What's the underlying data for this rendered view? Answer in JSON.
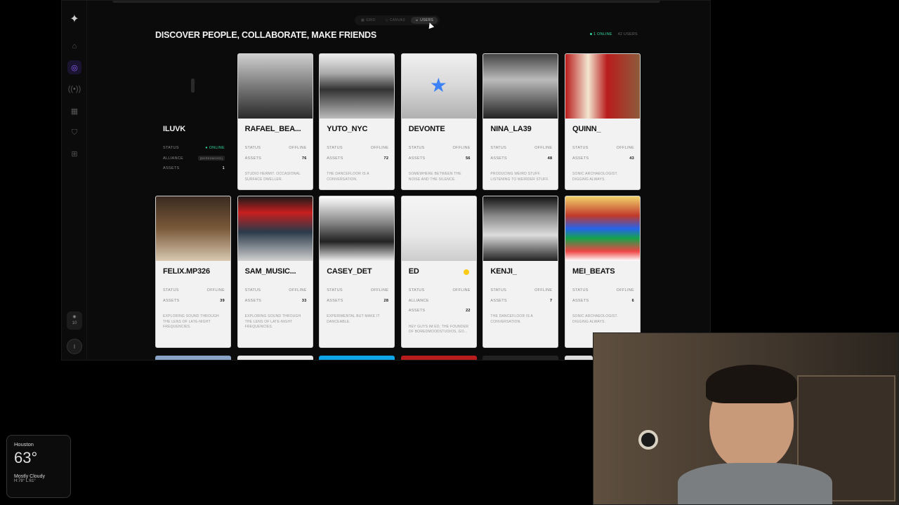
{
  "view_toggle": [
    {
      "label": "GRID",
      "icon": "grid-icon",
      "active": false
    },
    {
      "label": "CANVAS",
      "icon": "canvas-icon",
      "active": false
    },
    {
      "label": "USERS",
      "icon": "users-icon",
      "active": true
    }
  ],
  "page": {
    "title": "DISCOVER PEOPLE, COLLABORATE, MAKE FRIENDS",
    "online_count": "1 ONLINE",
    "user_count": "42 USERS"
  },
  "sidebar": {
    "notif_count": "10",
    "avatar_initial": "I",
    "icons": [
      "logo-icon",
      "home-icon",
      "compass-icon",
      "broadcast-icon",
      "calendar-icon",
      "shield-icon",
      "apps-icon"
    ]
  },
  "labels": {
    "status": "STATUS",
    "assets": "ASSETS",
    "alliance": "ALLIANCE"
  },
  "users": [
    {
      "name": "ILUVK",
      "status": "ONLINE",
      "assets": "1",
      "alliance": "[BOREDMOOD]",
      "bio": "",
      "dark": true
    },
    {
      "name": "RAFAEL_BEA...",
      "status": "OFFLINE",
      "assets": "76",
      "bio": "STUDIO HERMIT. OCCASIONAL SURFACE DWELLER."
    },
    {
      "name": "YUTO_NYC",
      "status": "OFFLINE",
      "assets": "72",
      "bio": "THE DANCEFLOOR IS A CONVERSATION."
    },
    {
      "name": "DEVONTE",
      "status": "OFFLINE",
      "assets": "56",
      "bio": "SOMEWHERE BETWEEN THE NOISE AND THE SILENCE."
    },
    {
      "name": "NINA_LA39",
      "status": "OFFLINE",
      "assets": "48",
      "bio": "PRODUCING WEIRD STUFF. LISTENING TO WEIRDER STUFF."
    },
    {
      "name": "QUINN_",
      "status": "OFFLINE",
      "assets": "43",
      "bio": "SONIC ARCHAEOLOGIST. DIGGING ALWAYS."
    },
    {
      "name": "FELIX.MP326",
      "status": "OFFLINE",
      "assets": "39",
      "bio": "EXPLORING SOUND THROUGH THE LENS OF LATE-NIGHT FREQUENCIES."
    },
    {
      "name": "SAM_MUSIC...",
      "status": "OFFLINE",
      "assets": "33",
      "bio": "EXPLORING SOUND THROUGH THE LENS OF LATE-NIGHT FREQUENCIES."
    },
    {
      "name": "CASEY_DET",
      "status": "OFFLINE",
      "assets": "28",
      "bio": "EXPERIMENTAL BUT MAKE IT DANCEABLE."
    },
    {
      "name": "ED",
      "status": "OFFLINE",
      "assets": "22",
      "alliance": "",
      "bio": "HEY GUYS IM ED, THE FOUNDER OF BOREDMOODSTUDIOS, GO..."
    },
    {
      "name": "KENJI_",
      "status": "OFFLINE",
      "assets": "7",
      "bio": "THE DANCEFLOOR IS A CONVERSATION."
    },
    {
      "name": "MEI_BEATS",
      "status": "OFFLINE",
      "assets": "6",
      "bio": "SONIC ARCHAEOLOGIST. DIGGING ALWAYS."
    }
  ],
  "weather": {
    "city": "Houston",
    "temp": "63°",
    "condition": "Mostly Cloudy",
    "hilo": "H:78° L:61°"
  }
}
